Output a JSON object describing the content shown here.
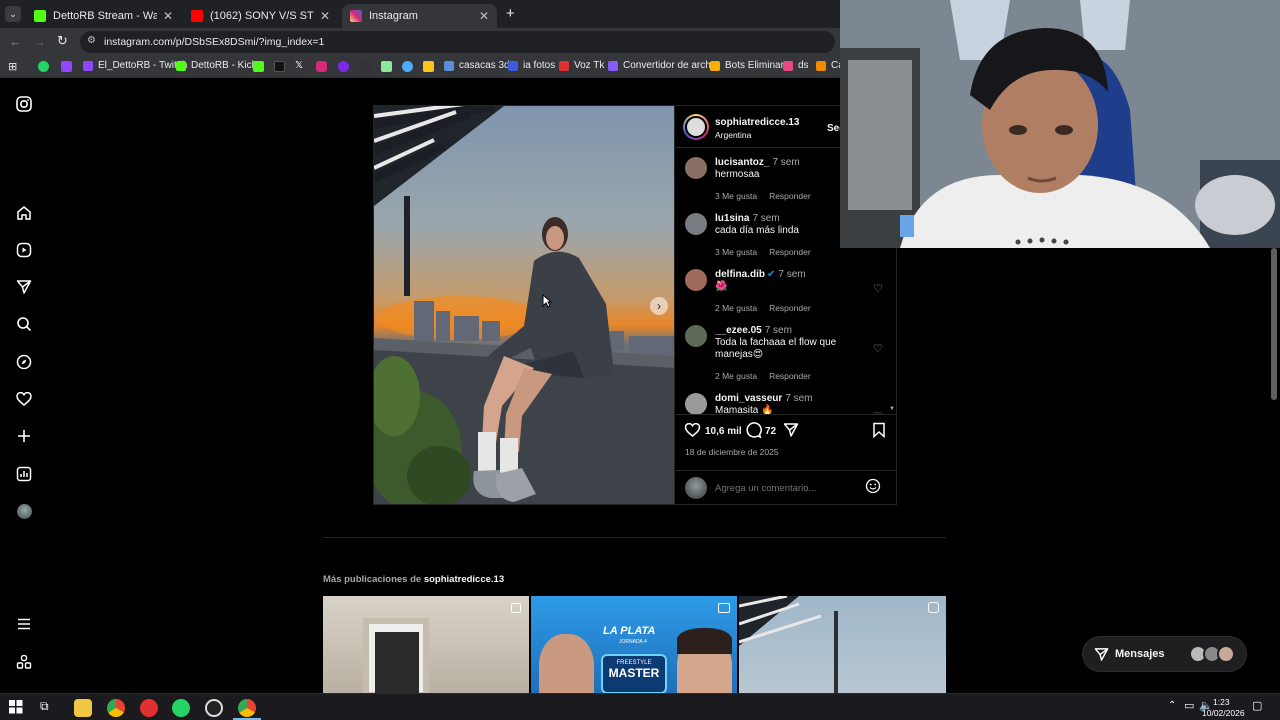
{
  "browser": {
    "tabs": [
      {
        "title": "DettoRB Stream - Watch Live o",
        "color": "#53fc18"
      },
      {
        "title": "(1062) SONY V/S STIGMA - Go",
        "color": "#ff0000"
      },
      {
        "title": "Instagram",
        "color": "#d6249f"
      }
    ],
    "new_tab_label": "+",
    "address": "instagram.com/p/DSbSEx8DSmi/?img_index=1",
    "bookmarks": [
      {
        "label": "El_DettoRB - Twitch",
        "color": "#9146ff"
      },
      {
        "label": "DettoRB - Kick",
        "color": "#53fc18"
      },
      {
        "label": "casacas 3d",
        "color": "#5a8fd8"
      },
      {
        "label": "ia fotos",
        "color": "#3b5bdb"
      },
      {
        "label": "Voz Tk",
        "color": "#e03131"
      },
      {
        "label": "Convertidor de arch...",
        "color": "#845ef7"
      },
      {
        "label": "Bots Eliminar",
        "color": "#fab005"
      },
      {
        "label": "ds",
        "color": "#e64980"
      },
      {
        "label": "Ca",
        "color": "#f08c00"
      }
    ]
  },
  "post": {
    "username": "sophiatredicce.13",
    "location": "Argentina",
    "follow_label": "Seg",
    "comments": [
      {
        "user": "lucisantoz_",
        "time": "7 sem",
        "text": "hermosaa",
        "likes": "3 Me gusta",
        "reply": "Responder"
      },
      {
        "user": "lu1sina",
        "time": "7 sem",
        "text": "cada día más linda",
        "likes": "3 Me gusta",
        "reply": "Responder"
      },
      {
        "user": "delfina.dib",
        "time": "7 sem",
        "text": "🌺",
        "likes": "2 Me gusta",
        "reply": "Responder"
      },
      {
        "user": "__ezee.05",
        "time": "7 sem",
        "text": "Toda la fachaaa el flow que manejas😍",
        "likes": "2 Me gusta",
        "reply": "Responder"
      },
      {
        "user": "domi_vasseur",
        "time": "7 sem",
        "text": "Mamasita 🔥",
        "likes": "",
        "reply": ""
      }
    ],
    "like_count": "10,6 mil",
    "comment_count": "72",
    "date": "18 de diciembre de 2025",
    "comment_placeholder": "Agrega un comentario..."
  },
  "more_posts": {
    "label": "Más publicaciones de",
    "user": "sophiatredicce.13",
    "thumb2": {
      "title": "LA PLATA",
      "sub": "JORNADA 4",
      "badge": "FREESTYLE",
      "badge2": "MASTER"
    }
  },
  "messages": {
    "label": "Mensajes"
  },
  "taskbar": {
    "time": "1:23",
    "date": "10/02/2026"
  },
  "colors": {
    "accent": "#0095f6",
    "bg": "#000000",
    "border": "#262626",
    "muted": "#a8a8a8"
  }
}
